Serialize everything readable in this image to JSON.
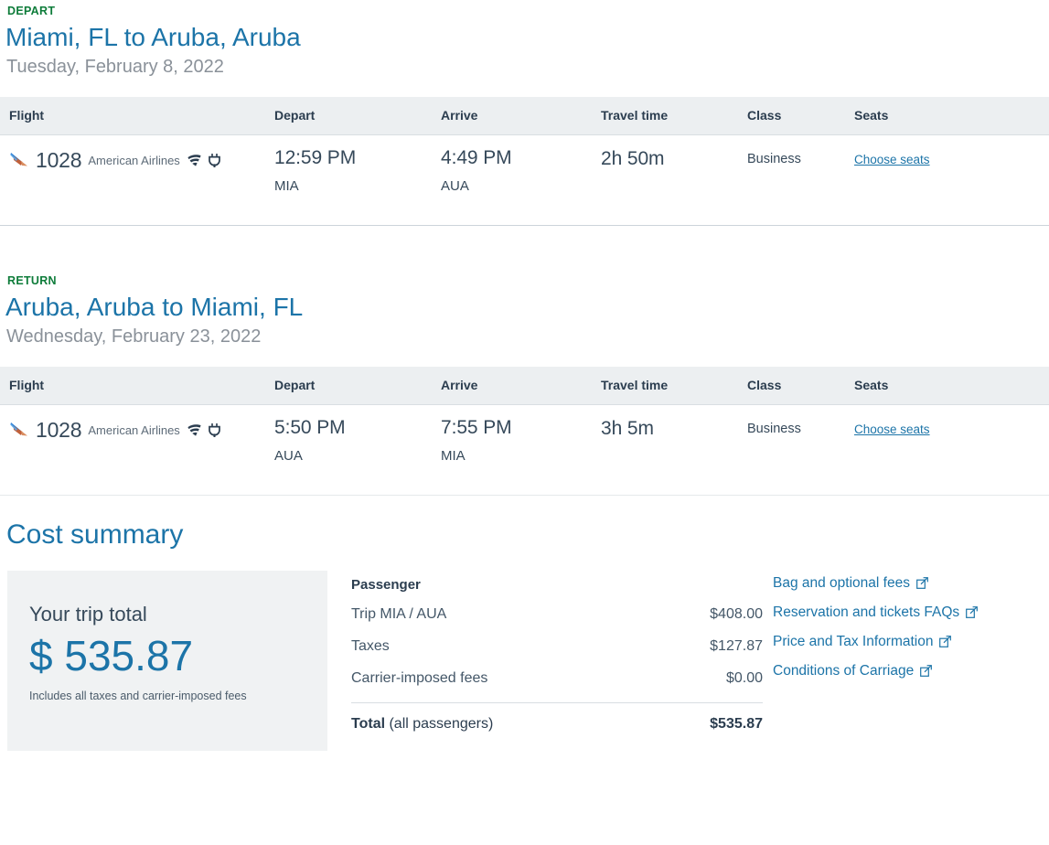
{
  "colors": {
    "heading_blue": "#1c74a8",
    "kicker_green": "#0e7c3a",
    "body_navy": "#36495a",
    "table_header_bg": "#eceff1",
    "total_box_bg": "#f0f2f3"
  },
  "table_headers": {
    "flight": "Flight",
    "depart": "Depart",
    "arrive": "Arrive",
    "travel_time": "Travel time",
    "class": "Class",
    "seats": "Seats"
  },
  "segments": [
    {
      "kicker": "DEPART",
      "title": "Miami, FL to Aruba, Aruba",
      "date": "Tuesday, February 8, 2022",
      "flight": {
        "number": "1028",
        "carrier": "American Airlines",
        "amenities": [
          "wifi-icon",
          "power-outlet-icon"
        ],
        "depart_time": "12:59 PM",
        "depart_code": "MIA",
        "arrive_time": "4:49 PM",
        "arrive_code": "AUA",
        "travel_time": "2h 50m",
        "cabin": "Business",
        "seats_link": "Choose seats"
      }
    },
    {
      "kicker": "RETURN",
      "title": "Aruba, Aruba to Miami, FL",
      "date": "Wednesday, February 23, 2022",
      "flight": {
        "number": "1028",
        "carrier": "American Airlines",
        "amenities": [
          "wifi-icon",
          "power-outlet-icon"
        ],
        "depart_time": "5:50 PM",
        "depart_code": "AUA",
        "arrive_time": "7:55 PM",
        "arrive_code": "MIA",
        "travel_time": "3h 5m",
        "cabin": "Business",
        "seats_link": "Choose seats"
      }
    }
  ],
  "cost_summary": {
    "title": "Cost summary",
    "trip_total": {
      "label": "Your trip total",
      "amount": "$ 535.87",
      "note": "Includes all taxes and carrier-imposed fees"
    },
    "passenger": {
      "header": "Passenger",
      "rows": [
        {
          "label": "Trip MIA / AUA",
          "amount": "$408.00"
        },
        {
          "label": "Taxes",
          "amount": "$127.87"
        },
        {
          "label": "Carrier-imposed fees",
          "amount": "$0.00"
        }
      ],
      "total_label_bold": "Total",
      "total_label_rest": " (all passengers)",
      "total_amount": "$535.87"
    },
    "links": [
      "Bag and optional fees",
      "Reservation and tickets FAQs",
      "Price and Tax Information",
      "Conditions of Carriage"
    ]
  }
}
